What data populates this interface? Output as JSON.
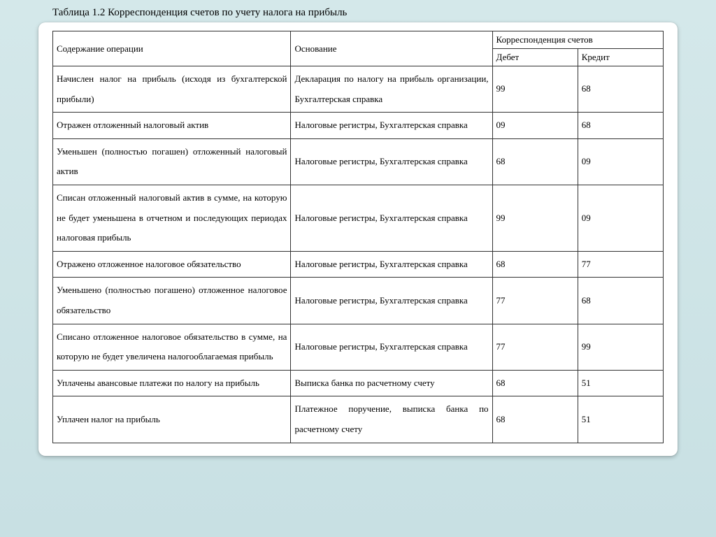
{
  "title": "Таблица 1.2 Корреспонденция счетов по учету налога на прибыль",
  "headers": {
    "operation": "Содержание операции",
    "basis": "Основание",
    "correspondence": "Корреспонденция счетов",
    "debit": "Дебет",
    "credit": "Кредит"
  },
  "chart_data": {
    "type": "table",
    "title": "Таблица 1.2 Корреспонденция счетов по учету налога на прибыль",
    "columns": [
      "Содержание операции",
      "Основание",
      "Дебет",
      "Кредит"
    ],
    "rows": [
      {
        "operation": "Начислен налог на прибыль (исходя из бухгалтерской прибыли)",
        "basis": "Декларация по налогу на прибыль организации, Бухгалтерская справка",
        "debit": "99",
        "credit": "68"
      },
      {
        "operation": "Отражен отложенный налоговый актив",
        "basis": "Налоговые регистры, Бухгалтерская справка",
        "debit": "09",
        "credit": "68"
      },
      {
        "operation": "Уменьшен (полностью погашен) отложенный налоговый актив",
        "basis": "Налоговые регистры, Бухгалтерская справка",
        "debit": "68",
        "credit": "09"
      },
      {
        "operation": "Списан отложенный налоговый актив в сумме, на которую не будет уменьшена в отчетном и последующих периодах налоговая прибыль",
        "basis": "Налоговые регистры, Бухгалтерская справка",
        "debit": "99",
        "credit": "09"
      },
      {
        "operation": "Отражено отложенное налоговое обязательство",
        "basis": "Налоговые регистры, Бухгалтерская справка",
        "debit": "68",
        "credit": "77"
      },
      {
        "operation": "Уменьшено (полностью погашено) отложенное налоговое обязательство",
        "basis": "Налоговые регистры, Бухгалтерская справка",
        "debit": "77",
        "credit": "68"
      },
      {
        "operation": "Списано отложенное налоговое обязательство в сумме, на которую не будет увеличена налогооблагаемая прибыль",
        "basis": "Налоговые регистры, Бухгалтерская справка",
        "debit": "77",
        "credit": "99"
      },
      {
        "operation": "Уплачены авансовые платежи по налогу на прибыль",
        "basis": "Выписка банка по расчетному счету",
        "debit": "68",
        "credit": "51"
      },
      {
        "operation": "Уплачен налог на прибыль",
        "basis": "Платежное поручение, выписка банка по расчетному счету",
        "debit": "68",
        "credit": "51"
      }
    ]
  }
}
